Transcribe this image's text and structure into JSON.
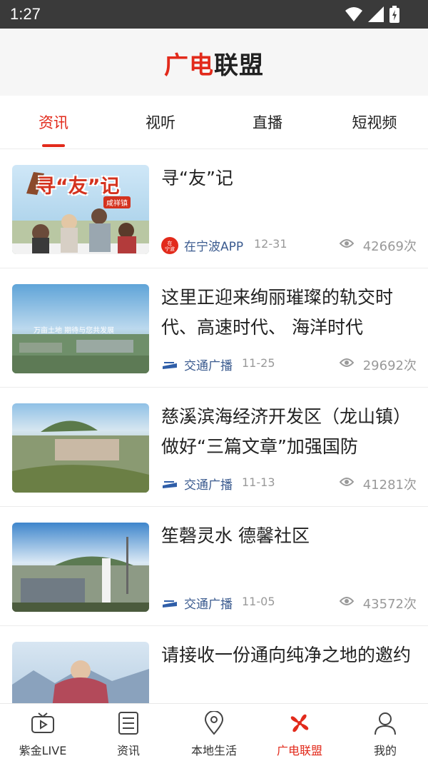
{
  "status_bar": {
    "time": "1:27"
  },
  "header": {
    "logo_part1": "广电",
    "logo_part2": "联盟"
  },
  "tabs": [
    {
      "label": "资讯",
      "active": true
    },
    {
      "label": "视听",
      "active": false
    },
    {
      "label": "直播",
      "active": false
    },
    {
      "label": "短视频",
      "active": false
    }
  ],
  "news": [
    {
      "title": "寻“友”记",
      "source": "在宁波APP",
      "date": "12-31",
      "views": "42669次",
      "source_icon": "zainingbo-logo-icon",
      "thumb_caption": "寻“友”记",
      "thumb_badge": "咸祥镇"
    },
    {
      "title": "这里正迎来绚丽璀璨的轨交时代、高速时代、 海洋时代",
      "source": "交通广播",
      "date": "11-25",
      "views": "29692次",
      "source_icon": "traffic-radio-logo-icon",
      "thumb_caption": "万亩土地 期待与您共发展"
    },
    {
      "title": "慈溪滨海经济开发区（龙山镇）做好“三篇文章”加强国防",
      "source": "交通广播",
      "date": "11-13",
      "views": "41281次",
      "source_icon": "traffic-radio-logo-icon"
    },
    {
      "title": "笙磬灵水 德馨社区",
      "source": "交通广播",
      "date": "11-05",
      "views": "43572次",
      "source_icon": "traffic-radio-logo-icon"
    },
    {
      "title": "请接收一份通向纯净之地的邀约",
      "source": "",
      "date": "",
      "views": ""
    }
  ],
  "bottom_nav": [
    {
      "label": "紫金LIVE",
      "icon": "tv-play-icon",
      "active": false
    },
    {
      "label": "资讯",
      "icon": "news-list-icon",
      "active": false
    },
    {
      "label": "本地生活",
      "icon": "location-pin-icon",
      "active": false
    },
    {
      "label": "广电联盟",
      "icon": "alliance-logo-icon",
      "active": true
    },
    {
      "label": "我的",
      "icon": "person-icon",
      "active": false
    }
  ],
  "colors": {
    "accent": "#e22a1b",
    "source_link": "#3b5b8f",
    "meta_gray": "#999999"
  }
}
